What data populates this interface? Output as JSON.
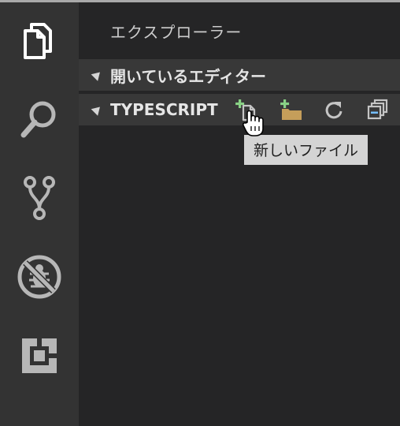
{
  "explorer": {
    "title": "エクスプローラー",
    "sections": [
      {
        "label": "開いているエディター",
        "expanded": true
      },
      {
        "label": "TYPESCRIPT",
        "expanded": true
      }
    ],
    "toolbar": [
      {
        "icon": "new-file-icon",
        "tooltip": "新しいファイル"
      },
      {
        "icon": "new-folder-icon"
      },
      {
        "icon": "refresh-icon"
      },
      {
        "icon": "collapse-all-icon"
      }
    ],
    "tooltip": "新しいファイル"
  },
  "activity_bar": {
    "items": [
      {
        "icon": "explorer-icon",
        "active": true
      },
      {
        "icon": "search-icon"
      },
      {
        "icon": "source-control-icon"
      },
      {
        "icon": "debug-icon"
      },
      {
        "icon": "extensions-icon"
      }
    ]
  },
  "colors": {
    "activity_bar_bg": "#333333",
    "sidebar_bg": "#252526",
    "section_header_bg": "#383838",
    "plus_green": "#89d185",
    "folder_tan": "#c59e5a",
    "tooltip_bg": "#d4d4d4"
  }
}
